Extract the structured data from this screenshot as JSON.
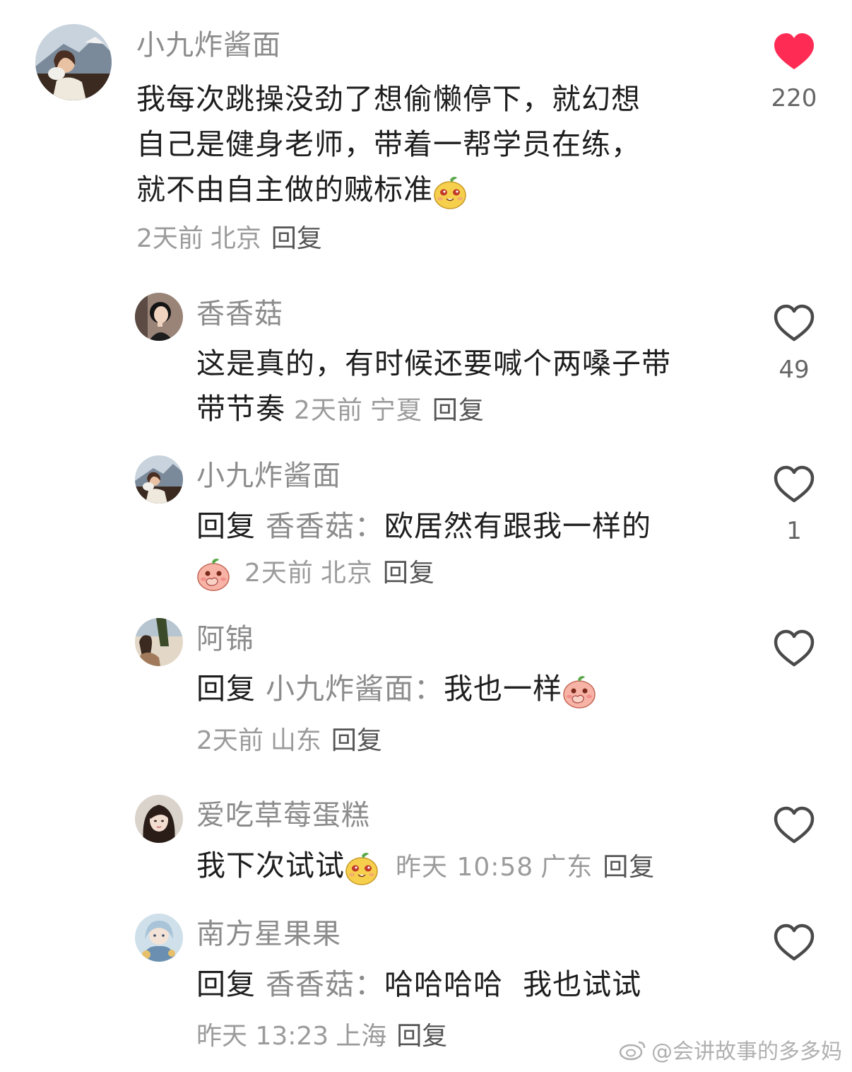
{
  "colors": {
    "like_active": "#fe2c55",
    "like_outline": "#4a4a4a",
    "muted": "#9b9b9b"
  },
  "comments": [
    {
      "username": "小九炸酱面",
      "lines": [
        "我每次跳操没劲了想偷懒停下，就幻想",
        "自己是健身老师，带着一帮学员在练，",
        "就不由自主做的贼标准"
      ],
      "emoji": "yellow-blob-emoji",
      "time": "2天前",
      "location": "北京",
      "reply_label": "回复",
      "likes": "220",
      "liked": true
    },
    {
      "username": "香香菇",
      "lines": [
        "这是真的，有时候还要喊个两嗓子带",
        "带节奏"
      ],
      "time": "2天前",
      "location": "宁夏",
      "reply_label": "回复",
      "likes": "49"
    },
    {
      "username": "小九炸酱面",
      "prefix": "回复",
      "mention": "香香菇：",
      "text": "欧居然有跟我一样的",
      "emoji": "pink-blob-emoji",
      "time": "2天前",
      "location": "北京",
      "reply_label": "回复",
      "likes": "1"
    },
    {
      "username": "阿锦",
      "prefix": "回复",
      "mention": "小九炸酱面：",
      "text": "我也一样",
      "emoji": "pink-blob-emoji",
      "time": "2天前",
      "location": "山东",
      "reply_label": "回复"
    },
    {
      "username": "爱吃草莓蛋糕",
      "text": "我下次试试",
      "emoji": "yellow-blob-emoji",
      "time": "昨天 10:58",
      "location": "广东",
      "reply_label": "回复"
    },
    {
      "username": "南方星果果",
      "prefix": "回复",
      "mention": "香香菇：",
      "text": "哈哈哈哈  我也试试",
      "time": "昨天 13:23",
      "location": "上海",
      "reply_label": "回复"
    }
  ],
  "watermark": "@会讲故事的多多妈"
}
